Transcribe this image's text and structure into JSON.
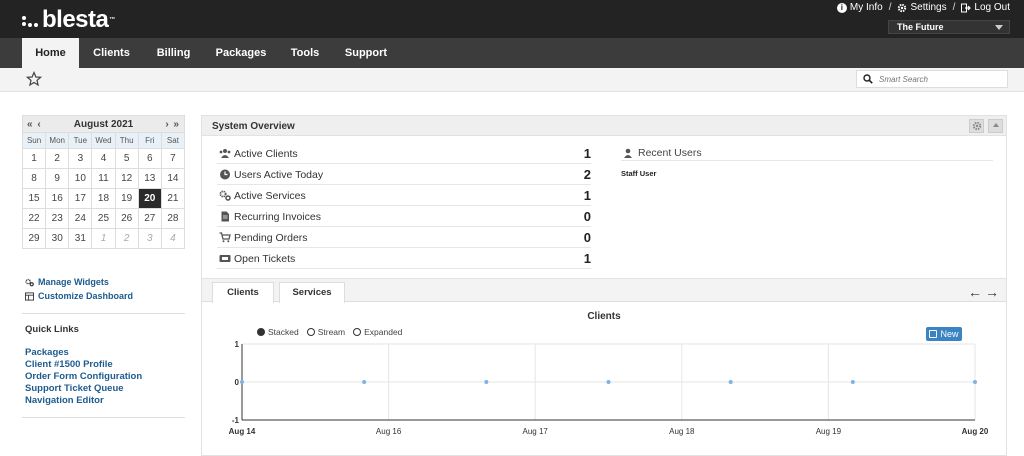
{
  "header": {
    "brand": "blesta",
    "brand_tm": "™",
    "my_info": "My Info",
    "settings": "Settings",
    "logout": "Log Out",
    "company": "The Future"
  },
  "nav": {
    "tabs": [
      {
        "label": "Home",
        "active": true
      },
      {
        "label": "Clients"
      },
      {
        "label": "Billing"
      },
      {
        "label": "Packages"
      },
      {
        "label": "Tools"
      },
      {
        "label": "Support"
      }
    ]
  },
  "search": {
    "placeholder": "Smart Search"
  },
  "calendar": {
    "month": "August 2021",
    "prev": "« ‹",
    "next": "› »",
    "weekdays": [
      "Sun",
      "Mon",
      "Tue",
      "Wed",
      "Thu",
      "Fri",
      "Sat"
    ],
    "weeks": [
      [
        {
          "d": "1"
        },
        {
          "d": "2"
        },
        {
          "d": "3"
        },
        {
          "d": "4"
        },
        {
          "d": "5"
        },
        {
          "d": "6"
        },
        {
          "d": "7"
        }
      ],
      [
        {
          "d": "8"
        },
        {
          "d": "9"
        },
        {
          "d": "10"
        },
        {
          "d": "11"
        },
        {
          "d": "12"
        },
        {
          "d": "13"
        },
        {
          "d": "14"
        }
      ],
      [
        {
          "d": "15"
        },
        {
          "d": "16"
        },
        {
          "d": "17"
        },
        {
          "d": "18"
        },
        {
          "d": "19"
        },
        {
          "d": "20",
          "today": true
        },
        {
          "d": "21"
        }
      ],
      [
        {
          "d": "22"
        },
        {
          "d": "23"
        },
        {
          "d": "24"
        },
        {
          "d": "25"
        },
        {
          "d": "26"
        },
        {
          "d": "27"
        },
        {
          "d": "28"
        }
      ],
      [
        {
          "d": "29"
        },
        {
          "d": "30"
        },
        {
          "d": "31"
        },
        {
          "d": "1",
          "other": true
        },
        {
          "d": "2",
          "other": true
        },
        {
          "d": "3",
          "other": true
        },
        {
          "d": "4",
          "other": true
        }
      ]
    ]
  },
  "sidebar": {
    "manage_widgets": "Manage Widgets",
    "customize_dashboard": "Customize Dashboard",
    "quick_links_title": "Quick Links",
    "quick_links": [
      "Packages",
      "Client #1500 Profile",
      "Order Form Configuration",
      "Support Ticket Queue",
      "Navigation Editor"
    ]
  },
  "overview": {
    "title": "System Overview",
    "stats": [
      {
        "label": "Active Clients",
        "value": "1",
        "icon": "users-icon"
      },
      {
        "label": "Users Active Today",
        "value": "2",
        "icon": "clock-icon"
      },
      {
        "label": "Active Services",
        "value": "1",
        "icon": "cogs-icon"
      },
      {
        "label": "Recurring Invoices",
        "value": "0",
        "icon": "file-icon"
      },
      {
        "label": "Pending Orders",
        "value": "0",
        "icon": "cart-icon"
      },
      {
        "label": "Open Tickets",
        "value": "1",
        "icon": "ticket-icon"
      }
    ],
    "recent_users_title": "Recent Users",
    "recent_users": [
      "Staff User"
    ]
  },
  "tabs": {
    "clients": "Clients",
    "services": "Services"
  },
  "chart_data": {
    "type": "line",
    "title": "Clients",
    "legend_modes": [
      "Stacked",
      "Stream",
      "Expanded"
    ],
    "selected_mode": "Stacked",
    "new_label": "New",
    "x_labels": [
      "Aug 14",
      "Aug 16",
      "Aug 17",
      "Aug 18",
      "Aug 19",
      "Aug 20"
    ],
    "y_ticks": [
      "1",
      "0",
      "-1"
    ],
    "ylim": [
      -1,
      1
    ],
    "series": [
      {
        "name": "New",
        "color": "#7fb2e5",
        "values": [
          0,
          0,
          0,
          0,
          0,
          0,
          0
        ]
      }
    ],
    "grid": true
  },
  "colors": {
    "accent": "#3a84c4",
    "link": "#1d5b8f",
    "topbar": "#232323",
    "nav": "#3c3c3c"
  }
}
